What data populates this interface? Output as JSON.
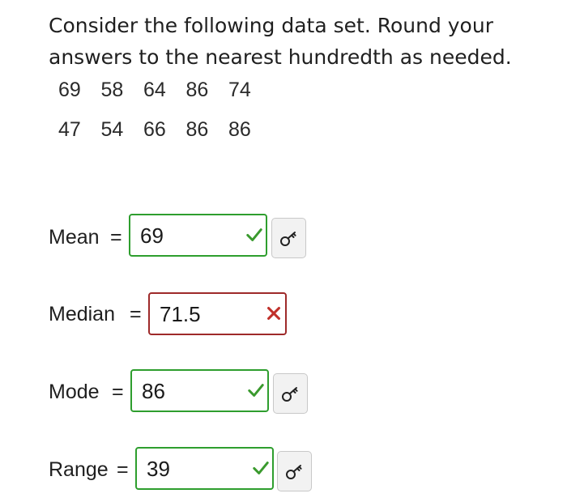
{
  "question": {
    "line1": "Consider the following data set. Round your",
    "line2": "answers to the nearest hundredth as needed."
  },
  "data_rows": [
    [
      "69",
      "58",
      "64",
      "86",
      "74"
    ],
    [
      "47",
      "54",
      "66",
      "86",
      "86"
    ]
  ],
  "answers": {
    "mean": {
      "label": "Mean",
      "equals": "=",
      "value": "69",
      "status": "correct"
    },
    "median": {
      "label": "Median",
      "equals": "=",
      "value": "71.5",
      "status": "incorrect"
    },
    "mode": {
      "label": "Mode",
      "equals": "=",
      "value": "86",
      "status": "correct"
    },
    "range": {
      "label": "Range",
      "equals": "=",
      "value": "39",
      "status": "correct"
    }
  },
  "icons": {
    "correct": "checkmark-icon",
    "incorrect": "x-mark-icon",
    "answer_key": "key-icon"
  },
  "colors": {
    "correct": "#2e9e2e",
    "incorrect": "#9e2a2a",
    "check_mark": "#3a9a2e",
    "x_mark": "#c0302a"
  }
}
